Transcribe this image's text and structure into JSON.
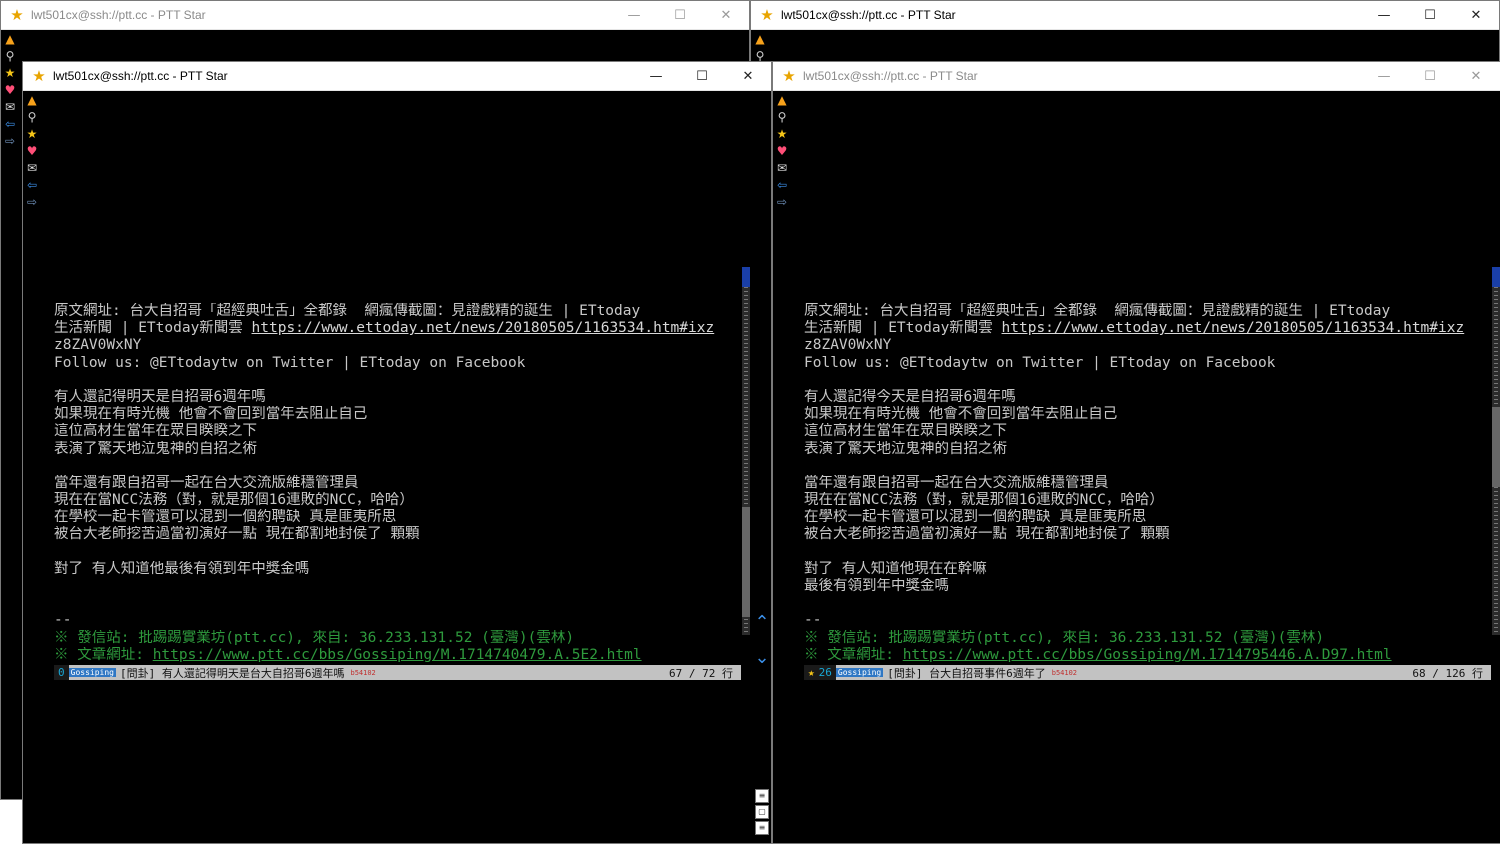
{
  "windows": {
    "bg_left_title": "lwt501cx@ssh://ptt.cc - PTT Star",
    "bg_right_title": "lwt501cx@ssh://ptt.cc - PTT Star",
    "front_left_title": "lwt501cx@ssh://ptt.cc - PTT Star",
    "front_right_title": "lwt501cx@ssh://ptt.cc - PTT Star",
    "controls": {
      "minimize": "—",
      "maximize": "☐",
      "close": "✕"
    }
  },
  "toolstrip": [
    "fire-icon",
    "search-icon",
    "star-icon",
    "heart-icon",
    "mail-icon",
    "back-arrow-icon",
    "forward-arrow-icon"
  ],
  "left_article": {
    "lines": [
      "原文網址: 台大自招哥「超經典吐舌」全都錄  網瘋傳截圖：見證戲精的誕生 | ETtoday",
      "z8ZAV0WxNY",
      "Follow us: @ETtodaytw on Twitter | ETtoday on Facebook",
      "",
      "有人還記得明天是自招哥6週年嗎",
      "如果現在有時光機 他會不會回到當年去阻止自己",
      "這位高材生當年在眾目睽睽之下",
      "表演了驚天地泣鬼神的自招之術",
      "",
      "當年還有跟自招哥一起在台大交流版維穩管理員",
      "現在在當NCC法務（對，就是那個16連敗的NCC，哈哈）",
      "在學校一起卡管還可以混到一個約聘缺 真是匪夷所思",
      "被台大老師挖苦過當初演好一點 現在都割地封侯了 顆顆",
      "",
      "對了 有人知道他最後有領到年中獎金嗎",
      "",
      "",
      "--"
    ],
    "line2_prefix": "生活新聞 | ETtoday新聞雲 ",
    "line2_link": "https://www.ettoday.net/news/20180505/1163534.htm#ixz",
    "sig1": "※ 發信站: 批踢踢實業坊(ptt.cc), 來自: 36.233.131.52 (臺灣)(雲林)",
    "sig2_prefix": "※ 文章網址: ",
    "sig2_link": "https://www.ptt.cc/bbs/Gossiping/M.1714740479.A.5E2.html",
    "status": {
      "count": "0",
      "board": "Gossiping",
      "title": "[問卦] 有人還記得明天是台大自招哥6週年嗎",
      "sub": "b54102",
      "position": "67 / 72 行"
    }
  },
  "right_article": {
    "lines": [
      "原文網址: 台大自招哥「超經典吐舌」全都錄  網瘋傳截圖：見證戲精的誕生 | ETtoday",
      "z8ZAV0WxNY",
      "Follow us: @ETtodaytw on Twitter | ETtoday on Facebook",
      "",
      "有人還記得今天是自招哥6週年嗎",
      "如果現在有時光機 他會不會回到當年去阻止自己",
      "這位高材生當年在眾目睽睽之下",
      "表演了驚天地泣鬼神的自招之術",
      "",
      "當年還有跟自招哥一起在台大交流版維穩管理員",
      "現在在當NCC法務（對，就是那個16連敗的NCC，哈哈）",
      "在學校一起卡管還可以混到一個約聘缺 真是匪夷所思",
      "被台大老師挖苦過當初演好一點 現在都割地封侯了 顆顆",
      "",
      "對了 有人知道他現在在幹嘛",
      "最後有領到年中獎金嗎",
      "",
      "--"
    ],
    "line2_prefix": "生活新聞 | ETtoday新聞雲 ",
    "line2_link": "https://www.ettoday.net/news/20180505/1163534.htm#ixz",
    "sig1": "※ 發信站: 批踢踢實業坊(ptt.cc), 來自: 36.233.131.52 (臺灣)(雲林)",
    "sig2_prefix": "※ 文章網址: ",
    "sig2_link": "https://www.ptt.cc/bbs/Gossiping/M.1714795446.A.D97.html",
    "status": {
      "count": "26",
      "board": "Gossiping",
      "title": "[問卦] 台大自招哥事件6週年了",
      "sub": "b54102",
      "position": "68 / 126 行"
    }
  }
}
